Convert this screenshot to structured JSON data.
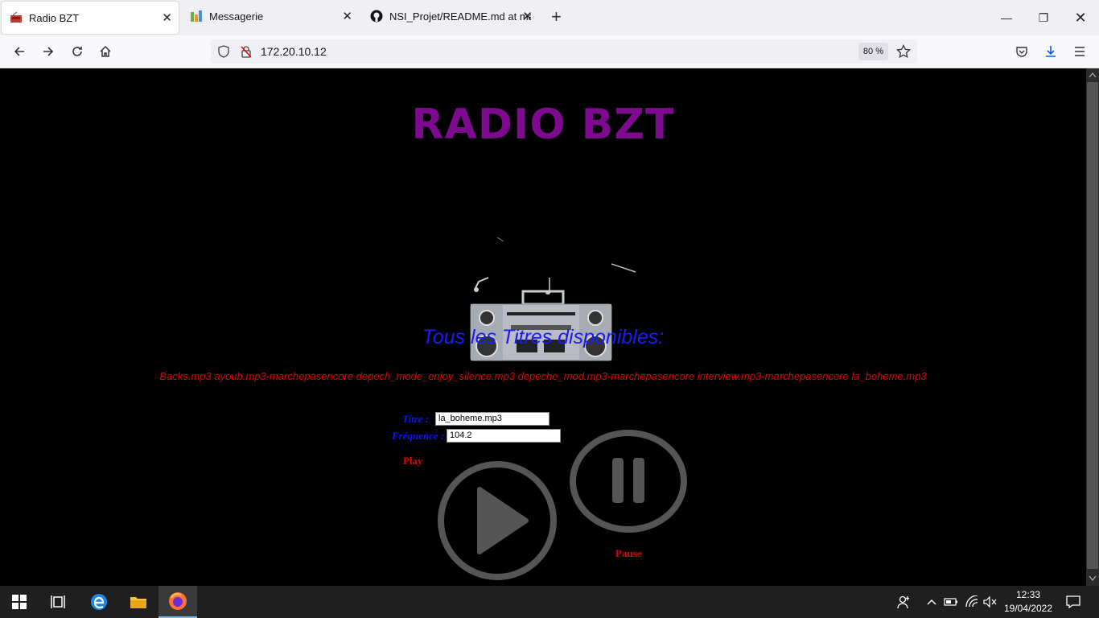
{
  "browser": {
    "tabs": [
      {
        "title": "Radio BZT",
        "icon": "radio-icon",
        "active": true
      },
      {
        "title": "Messagerie",
        "icon": "messagerie-icon",
        "active": false
      },
      {
        "title": "NSI_Projet/README.md at main",
        "icon": "github-icon",
        "active": false
      }
    ],
    "url": "172.20.10.12",
    "zoom": "80 %"
  },
  "page": {
    "title": "RADIO BZT",
    "subtitle": "Tous les Titres disponibles:",
    "tracks": "Backs.mp3 ayoub.mp3-marchepasencore depech_mode_enjoy_silence.mp3 depeche_mod.mp3-marchepasencore interview.mp3-marchepasencore la_boheme.mp3",
    "form": {
      "titre_label": "Titre :",
      "titre_value": "la_boheme.mp3",
      "frequence_label": "Fréquence :",
      "frequence_value": "104.2"
    },
    "play_label": "Play",
    "pause_label": "Pause"
  },
  "taskbar": {
    "time": "12:33",
    "date": "19/04/2022"
  },
  "colors": {
    "title": "#7d0a8f",
    "subtitle": "#1a1aff",
    "tracks": "#e00000",
    "form_label": "#1010ff",
    "button_label": "#e00000"
  }
}
